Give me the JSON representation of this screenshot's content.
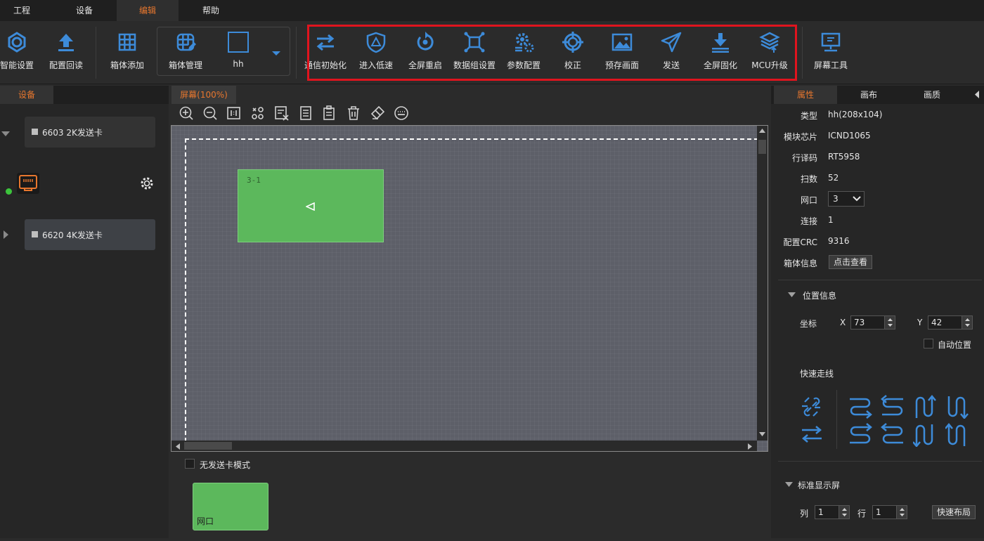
{
  "menu": [
    {
      "label": "工程"
    },
    {
      "label": "设备"
    },
    {
      "label": "编辑"
    },
    {
      "label": "帮助"
    }
  ],
  "toolbar": {
    "smart_setup": "智能设置",
    "config_readback": "配置回读",
    "box_add": "箱体添加",
    "box_manage": "箱体管理",
    "box_current": "hh",
    "comm_init": "通信初始化",
    "low_speed": "进入低速",
    "restart": "全屏重启",
    "data_group": "数据组设置",
    "param_config": "参数配置",
    "calibrate": "校正",
    "prestore": "预存画面",
    "send": "发送",
    "solidify": "全屏固化",
    "mcu_upgrade": "MCU升级",
    "screen_tool": "屏幕工具"
  },
  "colors": {
    "accent": "#e8772e",
    "icon_blue": "#3d8bd9",
    "highlight_red": "#e0141e",
    "module_green": "#5cb85c",
    "status_green": "#3cc43c"
  },
  "left_panel": {
    "tab": "设备",
    "card1": "6603 2K发送卡",
    "card2": "6620 4K发送卡"
  },
  "center": {
    "tab": "屏幕(100%)",
    "module_label": "3-1",
    "no_card_mode": "无发送卡模式",
    "port_label": "网口"
  },
  "right_panel": {
    "tabs": [
      "属性",
      "画布",
      "画质"
    ],
    "props": {
      "type_label": "类型",
      "type_val": "hh(208x104)",
      "chip_label": "模块芯片",
      "chip_val": "ICND1065",
      "decoder_label": "行译码",
      "decoder_val": "RT5958",
      "scan_label": "扫数",
      "scan_val": "52",
      "port_label": "网口",
      "port_val": "3",
      "conn_label": "连接",
      "conn_val": "1",
      "crc_label": "配置CRC",
      "crc_val": "9316",
      "boxinfo_label": "箱体信息",
      "boxinfo_btn": "点击查看"
    },
    "position": {
      "header": "位置信息",
      "coord_label": "坐标",
      "x_label": "X",
      "x_val": "73",
      "y_label": "Y",
      "y_val": "42",
      "auto_pos": "自动位置"
    },
    "quick_route": "快速走线",
    "standard": {
      "header": "标准显示屏",
      "col_label": "列",
      "col_val": "1",
      "row_label": "行",
      "row_val": "1",
      "layout_btn": "快速布局"
    }
  }
}
